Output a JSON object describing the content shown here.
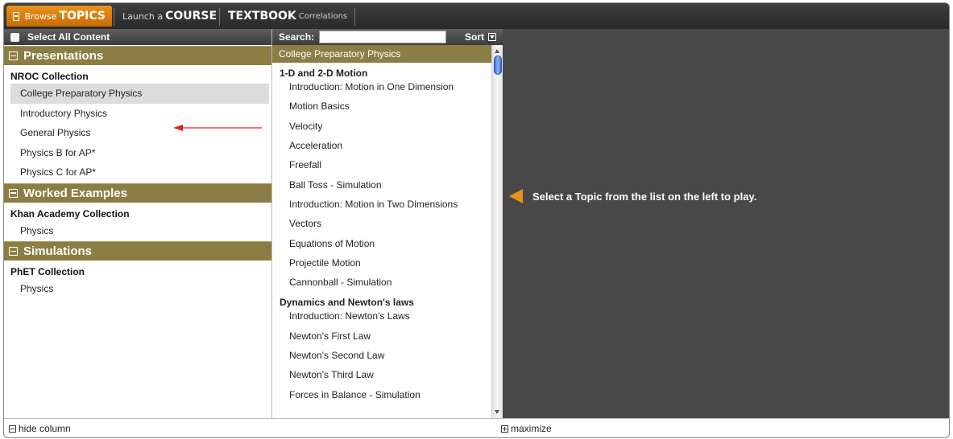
{
  "topbar": {
    "tabs": [
      {
        "small": "Browse",
        "big": "TOPICS",
        "after": ""
      },
      {
        "small": "Launch a",
        "big": "COURSE",
        "after": ""
      },
      {
        "small": "",
        "big": "TEXTBOOK",
        "after": "Correlations"
      }
    ]
  },
  "left": {
    "header_label": "Select All Content",
    "sections": [
      {
        "title": "Presentations",
        "collection": "NROC Collection",
        "items": [
          "College Preparatory Physics",
          "Introductory Physics",
          "General Physics",
          "Physics B for AP*",
          "Physics C for AP*"
        ]
      },
      {
        "title": "Worked Examples",
        "collection": "Khan Academy Collection",
        "items": [
          "Physics"
        ]
      },
      {
        "title": "Simulations",
        "collection": "PhET Collection",
        "items": [
          "Physics"
        ]
      }
    ],
    "selected_item": "College Preparatory Physics"
  },
  "middle": {
    "search_label": "Search:",
    "search_value": "",
    "sort_label": "Sort",
    "course_title": "College Preparatory Physics",
    "groups": [
      {
        "title": "1-D and 2-D Motion",
        "topics": [
          "Introduction: Motion in One Dimension",
          "Motion Basics",
          "Velocity",
          "Acceleration",
          "Freefall",
          "Ball Toss - Simulation",
          "Introduction: Motion in Two Dimensions",
          "Vectors",
          "Equations of Motion",
          "Projectile Motion",
          "Cannonball - Simulation"
        ]
      },
      {
        "title": "Dynamics and Newton's laws",
        "topics": [
          "Introduction: Newton's Laws",
          "Newton's First Law",
          "Newton's Second Law",
          "Newton's Third Law",
          "Forces in Balance - Simulation"
        ]
      }
    ]
  },
  "right": {
    "hint": "Select a Topic from the list on the left to play."
  },
  "bottombar": {
    "hide_column": "hide column",
    "maximize": "maximize"
  },
  "colors": {
    "accent_orange": "#e8901b",
    "section_olive": "#8b7d43",
    "arrow_red": "#e02020",
    "dark_pane": "#484848"
  }
}
